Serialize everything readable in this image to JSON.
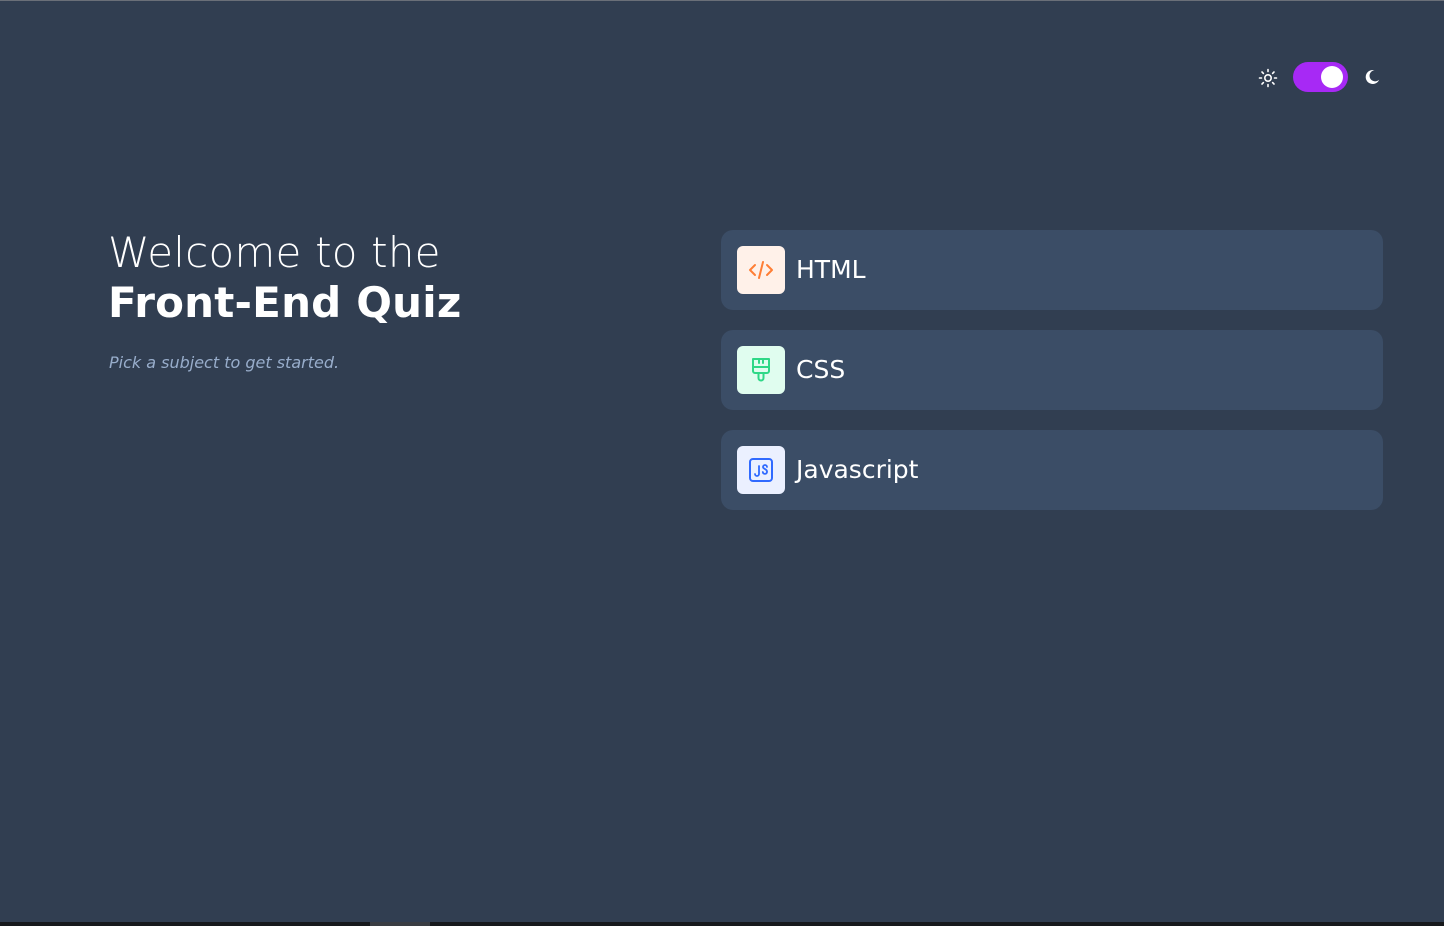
{
  "theme": {
    "mode": "dark",
    "sun_icon": "sun-icon",
    "moon_icon": "moon-icon",
    "accent": "#a729f5"
  },
  "hero": {
    "title_line1": "Welcome to the",
    "title_line2": "Front-End Quiz",
    "subtitle": "Pick a subject to get started."
  },
  "subjects": [
    {
      "label": "HTML",
      "icon": "code-icon",
      "icon_bg": "#fff1e9",
      "icon_color": "#ff7e35"
    },
    {
      "label": "CSS",
      "icon": "paintbrush-icon",
      "icon_bg": "#e0fdef",
      "icon_color": "#2fd887"
    },
    {
      "label": "Javascript",
      "icon": "js-icon",
      "icon_bg": "#ebf0ff",
      "icon_color": "#306aff"
    }
  ],
  "colors": {
    "background": "#313e51",
    "card": "#3b4d66",
    "text": "#ffffff",
    "muted": "#abc1e1"
  }
}
